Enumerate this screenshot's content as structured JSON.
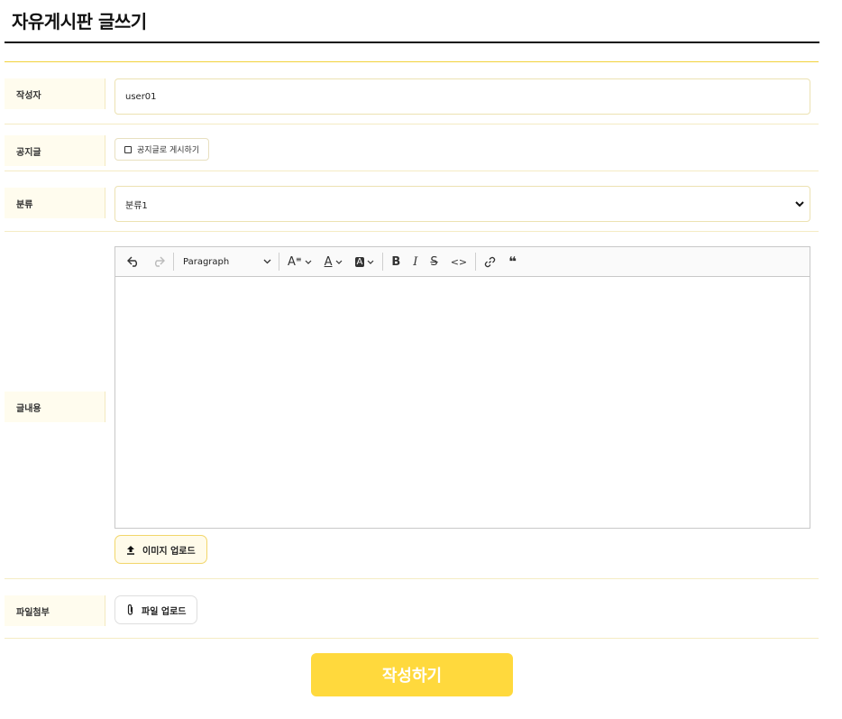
{
  "page_title": "자유게시판 글쓰기",
  "form": {
    "author": {
      "label": "작성자",
      "value": "user01"
    },
    "notice": {
      "label": "공지글",
      "checkbox_label": "공지글로 게시하기",
      "checked": false
    },
    "category": {
      "label": "분류",
      "selected": "분류1"
    },
    "content": {
      "label": "글내용",
      "toolbar": {
        "undo_icon": "undo-icon",
        "redo_icon": "redo-icon",
        "paragraph": "Paragraph",
        "items": [
          "font-size-icon",
          "font-color-icon",
          "background-color-icon",
          "bold-icon",
          "italic-icon",
          "strikethrough-icon",
          "code-icon",
          "link-icon",
          "blockquote-icon"
        ]
      },
      "image_upload": "이미지 업로드"
    },
    "attachment": {
      "label": "파일첨부",
      "file_upload": "파일 업로드"
    }
  },
  "submit_label": "작성하기",
  "colors": {
    "accent": "#ffd93d",
    "label_bg": "#fffcee",
    "border": "#ece2b2"
  }
}
